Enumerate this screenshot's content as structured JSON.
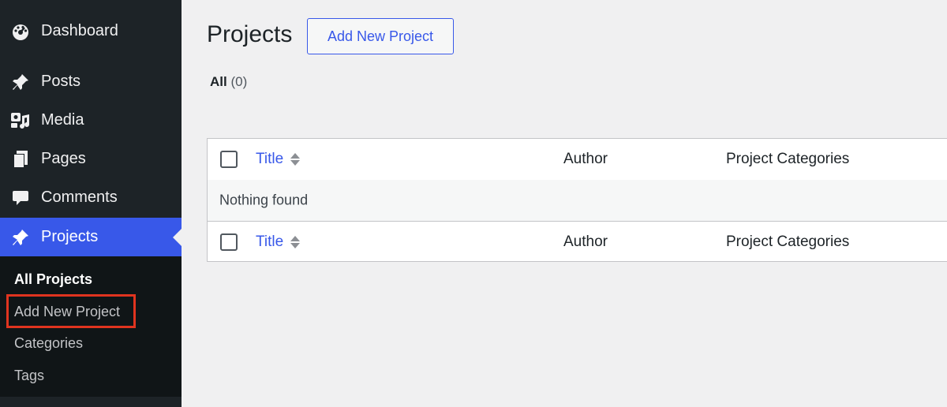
{
  "sidebar": {
    "items": [
      {
        "label": "Dashboard",
        "icon": "dashboard-icon"
      },
      {
        "label": "Posts",
        "icon": "pin-icon"
      },
      {
        "label": "Media",
        "icon": "media-icon"
      },
      {
        "label": "Pages",
        "icon": "pages-icon"
      },
      {
        "label": "Comments",
        "icon": "comment-icon"
      },
      {
        "label": "Projects",
        "icon": "pin-icon",
        "active": true
      }
    ],
    "submenu": [
      {
        "label": "All Projects",
        "current": true
      },
      {
        "label": "Add New Project",
        "highlighted": true
      },
      {
        "label": "Categories"
      },
      {
        "label": "Tags"
      }
    ]
  },
  "main": {
    "title": "Projects",
    "add_new_label": "Add New Project",
    "filter": {
      "all_label": "All",
      "all_count": "(0)"
    },
    "table": {
      "columns": {
        "title": "Title",
        "author": "Author",
        "categories": "Project Categories"
      },
      "empty_message": "Nothing found"
    }
  },
  "colors": {
    "sidebar_bg": "#1d2327",
    "active_bg": "#3858e9",
    "accent": "#3858e9",
    "highlight_border": "#e0341f",
    "page_bg": "#f0f0f1"
  }
}
